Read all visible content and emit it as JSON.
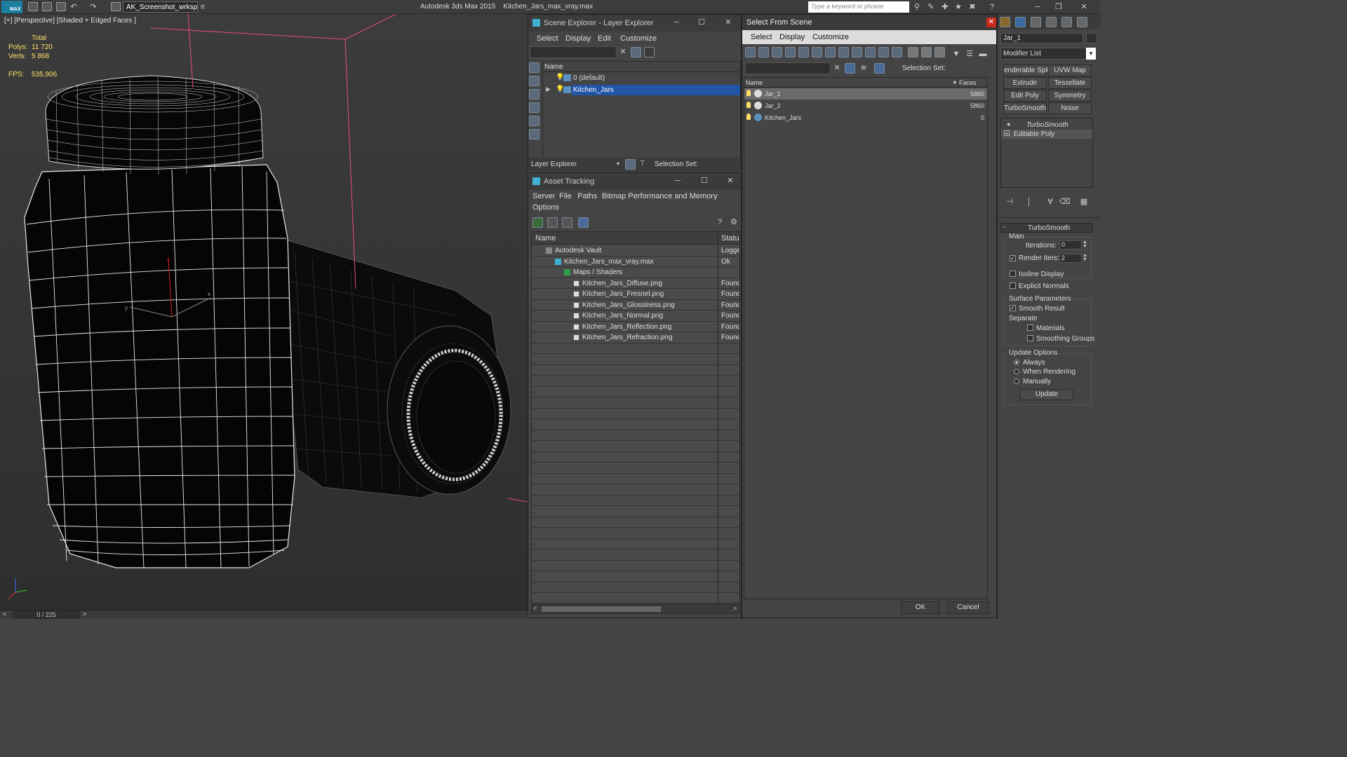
{
  "titlebar": {
    "logo": "MAX",
    "workspace": "AK_Screenshot_wrksp",
    "app_title": "Autodesk 3ds Max 2015",
    "file_title": "Kitchen_Jars_max_vray.max",
    "search_placeholder": "Type a keyword or phrase"
  },
  "viewport": {
    "label": "[+] [Perspective] [Shaded + Edged Faces ]",
    "stats": {
      "total_label": "Total",
      "polys_label": "Polys:",
      "polys_value": "11 720",
      "verts_label": "Verts:",
      "verts_value": "5 868",
      "fps_label": "FPS:",
      "fps_value": "535,906"
    }
  },
  "timebar": {
    "counter": "0 / 225"
  },
  "scene_explorer": {
    "title": "Scene Explorer - Layer Explorer",
    "menu": [
      "Select",
      "Display",
      "Edit",
      "Customize"
    ],
    "col_name": "Name",
    "layers": [
      {
        "name": "0 (default)",
        "selected": false
      },
      {
        "name": "Kitchen_Jars",
        "selected": true
      }
    ],
    "footer_dropdown": "Layer Explorer",
    "selection_set_label": "Selection Set:"
  },
  "asset_tracking": {
    "title": "Asset Tracking",
    "menu": [
      "Server",
      "File",
      "Paths",
      "Bitmap Performance and Memory",
      "Options"
    ],
    "col_name": "Name",
    "col_status": "Status",
    "rows": [
      {
        "name": "Autodesk Vault",
        "status": "Logge",
        "indent": 1
      },
      {
        "name": "Kitchen_Jars_max_vray.max",
        "status": "Ok",
        "indent": 2
      },
      {
        "name": "Maps / Shaders",
        "status": "",
        "indent": 3
      },
      {
        "name": "Kitchen_Jars_Diffuse.png",
        "status": "Found",
        "indent": 4
      },
      {
        "name": "Kitchen_Jars_Fresnel.png",
        "status": "Found",
        "indent": 4
      },
      {
        "name": "Kitchen_Jars_Glossiness.png",
        "status": "Found",
        "indent": 4
      },
      {
        "name": "Kitchen_Jars_Normal.png",
        "status": "Found",
        "indent": 4
      },
      {
        "name": "Kitchen_Jars_Reflection.png",
        "status": "Found",
        "indent": 4
      },
      {
        "name": "Kitchen_Jars_Refraction.png",
        "status": "Found",
        "indent": 4
      }
    ]
  },
  "select_from_scene": {
    "title": "Select From Scene",
    "menu": [
      "Select",
      "Display",
      "Customize"
    ],
    "selection_set_label": "Selection Set:",
    "col_name": "Name",
    "col_faces": "Faces",
    "rows": [
      {
        "name": "Jar_1",
        "faces": "5860",
        "selected": true
      },
      {
        "name": "Jar_2",
        "faces": "5860",
        "selected": false
      },
      {
        "name": "Kitchen_Jars",
        "faces": "0",
        "selected": false
      }
    ],
    "ok": "OK",
    "cancel": "Cancel"
  },
  "command_panel": {
    "object_name": "Jar_1",
    "modifier_list": "Modifier List",
    "buttons": [
      "enderable Spli",
      "UVW Map",
      "Extrude",
      "Tessellate",
      "Edit Poly",
      "Symmetry",
      "TurboSmooth",
      "Noise"
    ],
    "stack": [
      "TurboSmooth",
      "Editable Poly"
    ],
    "rollout_title": "TurboSmooth",
    "main_label": "Main",
    "iterations_label": "Iterations:",
    "iterations_value": "0",
    "render_iters_label": "Render Iters:",
    "render_iters_value": "2",
    "isoline_label": "Isoline Display",
    "explicit_normals_label": "Explicit Normals",
    "surface_params_label": "Surface Parameters",
    "smooth_result_label": "Smooth Result",
    "separate_label": "Separate",
    "materials_label": "Materials",
    "smoothing_groups_label": "Smoothing Groups",
    "update_options_label": "Update Options",
    "always_label": "Always",
    "when_rendering_label": "When Rendering",
    "manually_label": "Manually",
    "update_button": "Update"
  }
}
